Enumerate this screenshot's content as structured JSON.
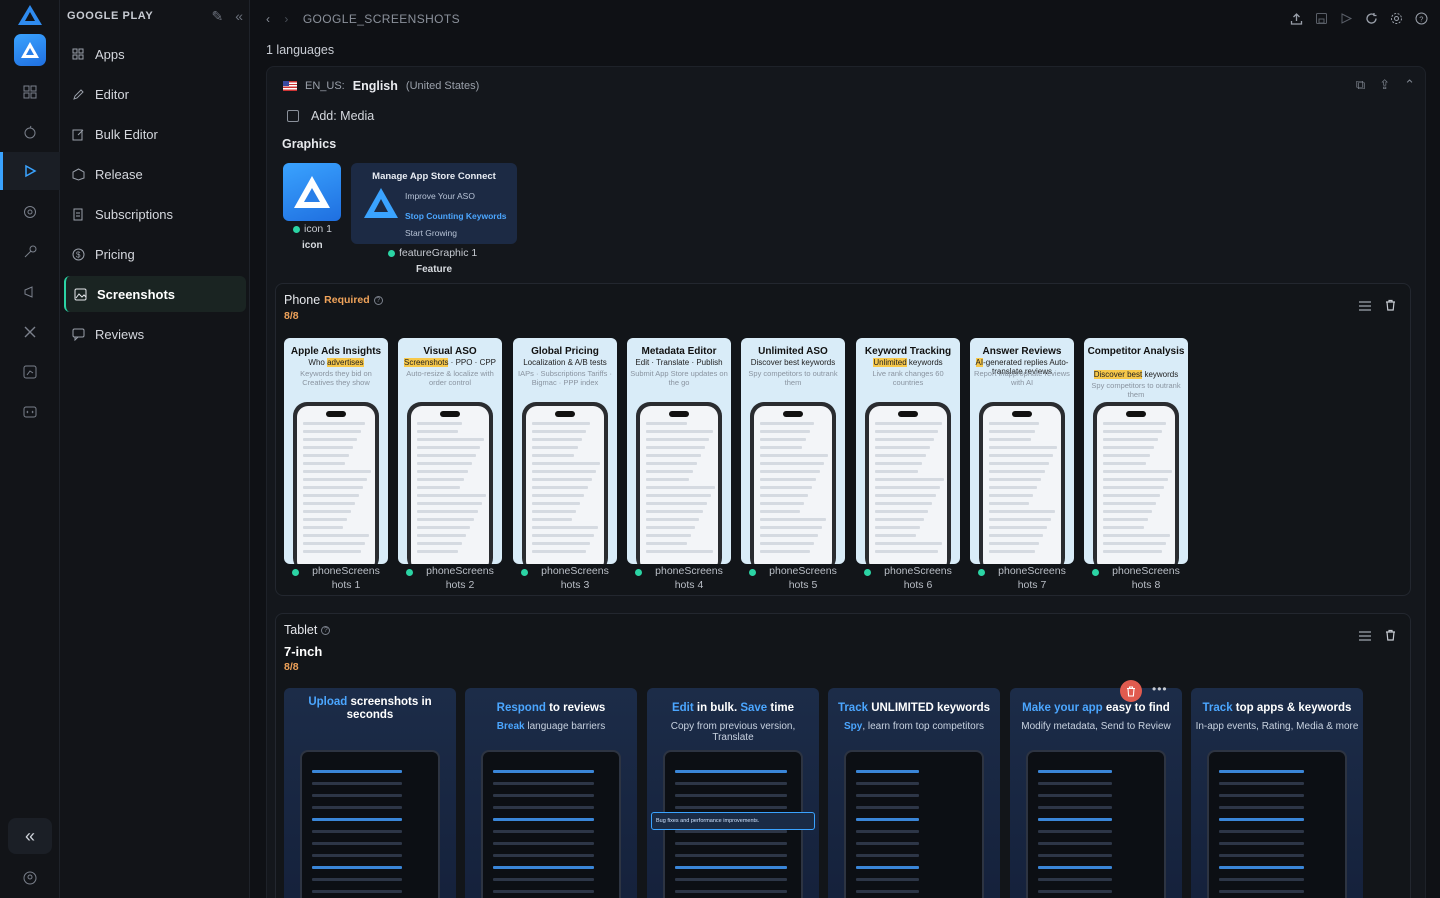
{
  "sidebar": {
    "brand": "GOOGLE PLAY",
    "items": [
      {
        "label": "Apps",
        "icon": "grid-icon"
      },
      {
        "label": "Editor",
        "icon": "pencil-icon"
      },
      {
        "label": "Bulk Editor",
        "icon": "edit-square-icon"
      },
      {
        "label": "Release",
        "icon": "package-icon"
      },
      {
        "label": "Subscriptions",
        "icon": "document-icon"
      },
      {
        "label": "Pricing",
        "icon": "dollar-icon"
      },
      {
        "label": "Screenshots",
        "icon": "image-icon",
        "active": true
      },
      {
        "label": "Reviews",
        "icon": "chat-icon"
      }
    ]
  },
  "topbar": {
    "breadcrumb": "GOOGLE_SCREENSHOTS"
  },
  "languages_count": "1 languages",
  "locale": {
    "code": "EN_US:",
    "language": "English",
    "region": "(United States)",
    "add_media": "Add: Media",
    "graphics_title": "Graphics",
    "icon": {
      "label": "icon 1",
      "type": "icon"
    },
    "feature": {
      "label": "featureGraphic 1",
      "type": "Feature",
      "title": "Manage App Store Connect",
      "line1": "Improve Your ASO",
      "line2": "Stop Counting Keywords",
      "line3": "Start Growing"
    }
  },
  "phone": {
    "title": "Phone",
    "required": "Required",
    "count": "8/8",
    "shots": [
      {
        "h1": "Apple Ads Insights",
        "h2a": "Who ",
        "h2b": "advertises",
        "h3": "Keywords they bid on Creatives they show",
        "label1": "phoneScreens",
        "label2": "hots 1"
      },
      {
        "h1": "Visual ASO",
        "h2a": "Screenshots",
        "h2b": " · PPO · CPP",
        "h3": "Auto-resize & localize with order control",
        "label1": "phoneScreens",
        "label2": "hots 2"
      },
      {
        "h1": "Global Pricing",
        "h2a": "Localization & A/B tests",
        "h2b": "",
        "h3": "IAPs · Subscriptions Tariffs · Bigmac · PPP index",
        "label1": "phoneScreens",
        "label2": "hots 3"
      },
      {
        "h1": "Metadata Editor",
        "h2a": "Edit · Translate · Publish",
        "h2b": "",
        "h3": "Submit App Store updates on the go",
        "label1": "phoneScreens",
        "label2": "hots 4"
      },
      {
        "h1": "Unlimited ASO",
        "h2a": "Discover best keywords",
        "h2b": "",
        "h3": "Spy competitors to outrank them",
        "label1": "phoneScreens",
        "label2": "hots 5"
      },
      {
        "h1": "Keyword Tracking",
        "h2a": "Unlimited",
        "h2b": " keywords",
        "h3": "Live rank changes 60 countries",
        "label1": "phoneScreens",
        "label2": "hots 6"
      },
      {
        "h1": "Answer Reviews",
        "h2a": "AI",
        "h2b": "-generated replies Auto-translate reviews",
        "h3": "Report inappropriate reviews with AI",
        "label1": "phoneScreens",
        "label2": "hots 7"
      },
      {
        "h1": "Competitor Analysis",
        "h2a": "Discover best",
        "h2b": " keywords",
        "h3": "Spy competitors to outrank them",
        "label1": "phoneScreens",
        "label2": "hots 8"
      }
    ]
  },
  "tablet": {
    "title": "Tablet",
    "size": "7-inch",
    "count": "8/8",
    "shots": [
      {
        "a": "Upload",
        "b": " screenshots in seconds",
        "sub_a": "",
        "sub_b": ""
      },
      {
        "a": "Respond",
        "b": " to reviews",
        "sub_a": "Break",
        "sub_b": " language barriers"
      },
      {
        "a": "Edit",
        "b": " in bulk. ",
        "c": "Save",
        "d": " time",
        "sub_a": "",
        "sub_b": "Copy from previous version, Translate"
      },
      {
        "a": "Track",
        "b": " UNLIMITED keywords",
        "sub_a": "Spy",
        "sub_b": ", learn from top competitors"
      },
      {
        "a": "Make your app",
        "b": " easy to find",
        "sub_a": "",
        "sub_b": "Modify metadata, Send to Review"
      },
      {
        "a": "Track",
        "b": " top apps & keywords",
        "sub_a": "",
        "sub_b": "In-app events, Rating, Media & more"
      }
    ],
    "banner_text": "Bug fixes and performance improvements."
  },
  "colors": {
    "accent": "#2bd4a4",
    "brand_blue": "#3aa3ff",
    "warning": "#f0a35a"
  }
}
